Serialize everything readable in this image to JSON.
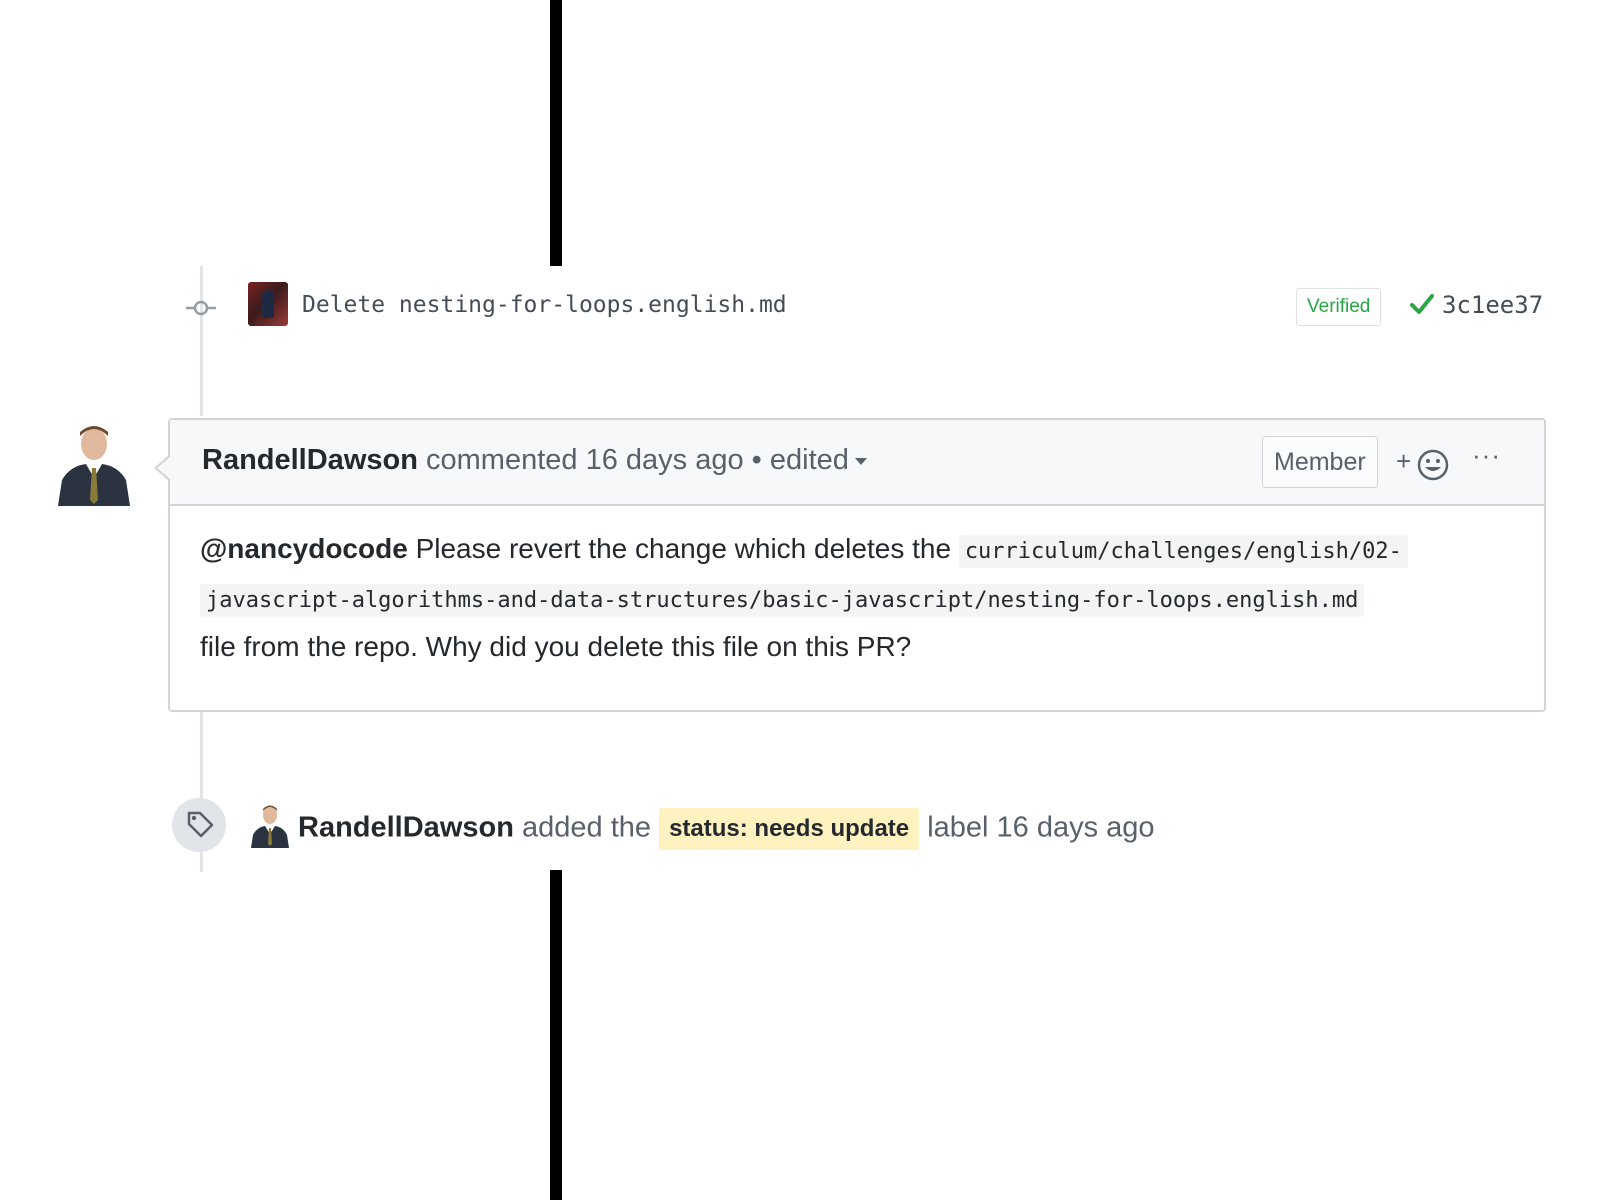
{
  "commit": {
    "message": "Delete nesting-for-loops.english.md",
    "verified_label": "Verified",
    "sha": "3c1ee37",
    "icons": {
      "commit": "git-commit-icon",
      "check": "check-icon"
    },
    "check_color": "#28a745"
  },
  "comment": {
    "author": "RandellDawson",
    "action": "commented",
    "time": "16 days ago",
    "separator": "•",
    "edited_label": "edited",
    "member_badge": "Member",
    "reaction_plus": "+",
    "more_label": "···",
    "body": {
      "mention": "@nancydocode",
      "text_before": "Please revert the change which deletes the",
      "code_line1": "curriculum/challenges/english/02-",
      "code_line2": "javascript-algorithms-and-data-structures/basic-javascript/nesting-for-loops.english.md",
      "text_after": "file from the repo. Why did you delete this file on this PR?"
    }
  },
  "label_event": {
    "author": "RandellDawson",
    "action": "added the",
    "label": "status: needs update",
    "label_color": "#fef2c0",
    "suffix": "label 16 days ago",
    "icon": "tag-icon"
  }
}
